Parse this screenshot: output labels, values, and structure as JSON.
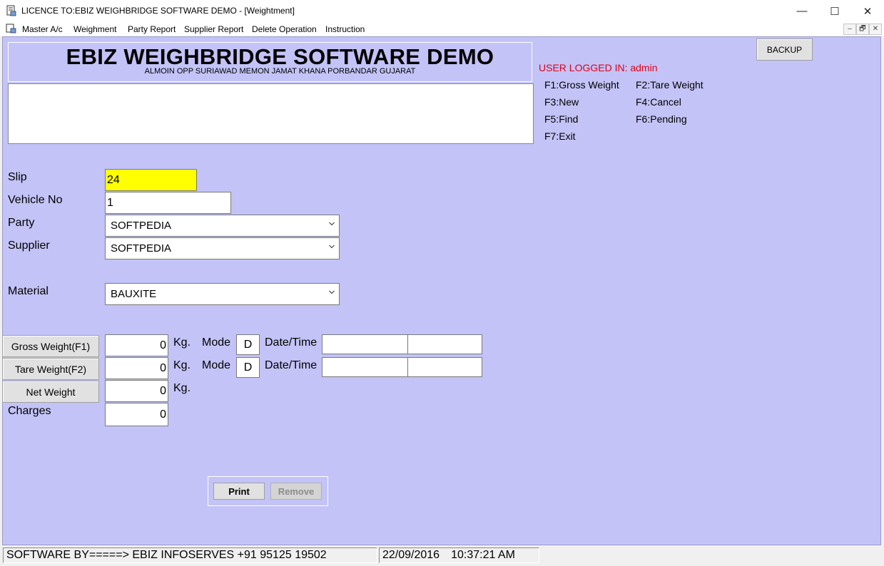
{
  "window": {
    "title": "LICENCE TO:EBIZ WEIGHBRIDGE SOFTWARE DEMO - [Weightment]",
    "controls": {
      "minimize": "—",
      "maximize": "☐",
      "close": "✕"
    }
  },
  "menu": {
    "items": [
      "Master A/c",
      "Weighment",
      "Party Report",
      "Supplier Report",
      "Delete Operation",
      "Instruction"
    ],
    "mdi_controls": [
      "–",
      "🗗",
      "✕"
    ]
  },
  "header": {
    "company_title": "EBIZ WEIGHBRIDGE SOFTWARE DEMO",
    "company_address": "ALMOIN OPP SURIAWAD MEMON JAMAT KHANA PORBANDAR GUJARAT"
  },
  "backup_label": "BACKUP",
  "user_logged_in": "USER LOGGED IN: admin",
  "function_keys": [
    "F1:Gross Weight",
    "F2:Tare Weight",
    "F3:New",
    "F4:Cancel",
    "F5:Find",
    "F6:Pending",
    "F7:Exit"
  ],
  "form": {
    "slip_label": "Slip",
    "slip_value": "24",
    "vehicle_label": "Vehicle No",
    "vehicle_value": "1",
    "party_label": "Party",
    "party_value": "SOFTPEDIA",
    "supplier_label": "Supplier",
    "supplier_value": "SOFTPEDIA",
    "material_label": "Material",
    "material_value": "BAUXITE"
  },
  "weights": {
    "gross_button": "Gross Weight(F1)",
    "tare_button": "Tare Weight(F2)",
    "net_button": "Net Weight",
    "charges_label": "Charges",
    "gross_value": "0",
    "tare_value": "0",
    "net_value": "0",
    "charges_value": "0",
    "unit": "Kg.",
    "mode_label": "Mode",
    "gross_mode": "D",
    "tare_mode": "D",
    "datetime_label": "Date/Time"
  },
  "actions": {
    "print": "Print",
    "remove": "Remove"
  },
  "status": {
    "software_by": "SOFTWARE BY=====> EBIZ INFOSERVES +91 95125 19502",
    "date": "22/09/2016",
    "time": "10:37:21 AM"
  },
  "colors": {
    "client_bg": "#c3c3f7",
    "slip_highlight": "#ffff00",
    "user_text": "#e0001a"
  }
}
